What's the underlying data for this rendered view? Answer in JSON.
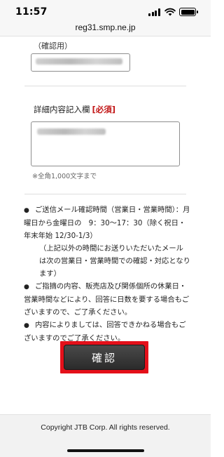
{
  "status_bar": {
    "time": "11:57",
    "icons": [
      "signal-icon",
      "wifi-icon",
      "battery-icon"
    ]
  },
  "browser": {
    "url": "reg31.smp.ne.jp"
  },
  "form": {
    "confirm_email_label": "（確認用）",
    "confirm_email_value": "",
    "details_label": "詳細内容記入欄",
    "required_mark": "[必須]",
    "details_value": "",
    "char_limit_note": "※全角1,000文字まで"
  },
  "info": {
    "bullet_symbol": "●",
    "item1_line1": "ご送信メール確認時間（営業日・営業時間）：",
    "item1_line2": "月曜日から金曜日の　9：30〜17：30（除く祝日・年末年始 12/30-1/3）",
    "item1_line3": "（上記以外の時間にお送りいただいたメールは次の営業日・営業時間での確認・対応となります）",
    "item2": "ご指摘の内容、販売店及び関係個所の休業日・営業時間などにより、回答に日数を要する場合もございますので、ご了承ください。",
    "item3": "内容によりましては、回答できかねる場合もございますのでご了承ください。"
  },
  "confirm_button": {
    "label": "確認",
    "highlight_color": "#e4101a"
  },
  "footer": {
    "copyright": "Copyright JTB Corp. All rights reserved."
  }
}
